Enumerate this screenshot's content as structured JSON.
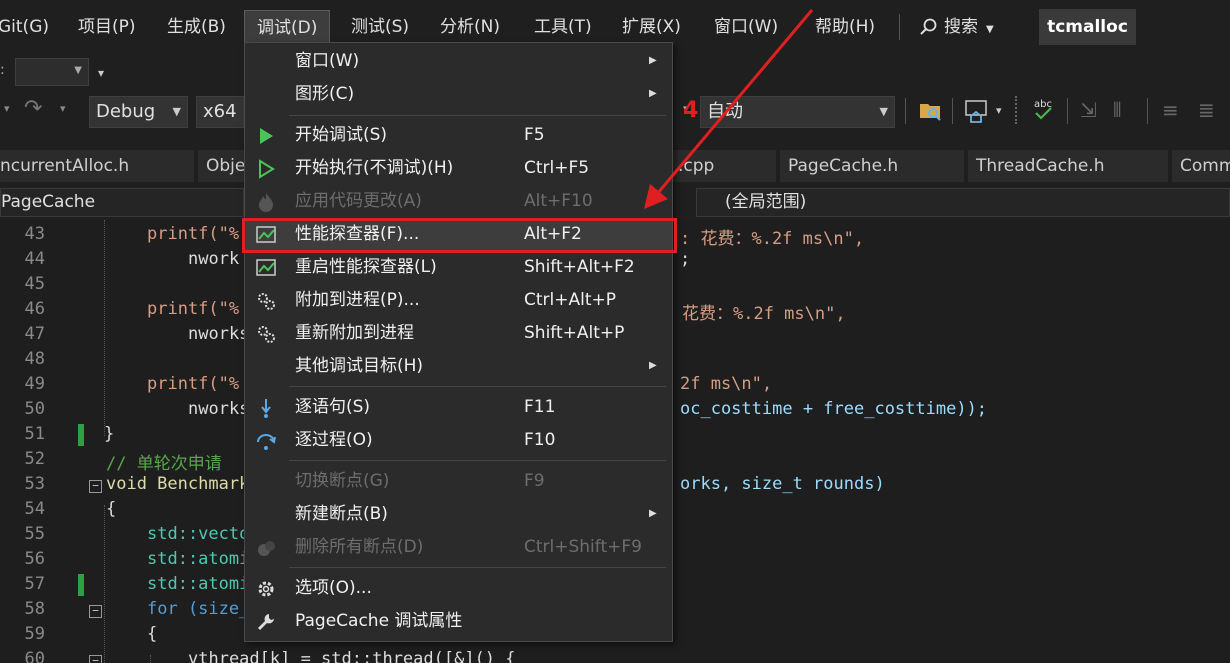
{
  "menubar": {
    "items": [
      "Git(G)",
      "项目(P)",
      "生成(B)",
      "调试(D)",
      "测试(S)",
      "分析(N)",
      "工具(T)",
      "扩展(X)",
      "窗口(W)",
      "帮助(H)"
    ],
    "search_label": "搜索",
    "solution_name": "tcmalloc"
  },
  "toolbar": {
    "config": "Debug",
    "platform": "x64",
    "startup": "自动"
  },
  "tabs": [
    "ncurrentAlloc.h",
    "Obje",
    ".cpp",
    "PageCache.h",
    "ThreadCache.h",
    "Comm"
  ],
  "navbar": {
    "project": "PageCache",
    "scope": "(全局范围)"
  },
  "editor": {
    "line_numbers": [
      "43",
      "44",
      "45",
      "46",
      "47",
      "48",
      "49",
      "50",
      "51",
      "52",
      "53",
      "54",
      "55",
      "56",
      "57",
      "58",
      "59",
      "60"
    ],
    "lines": {
      "l43a": "printf(\"%",
      "l43b": ": 花费：%.2f ms\\n\",",
      "l44a": "nwork",
      "l44b": ";",
      "l46a": "printf(\"%",
      "l46b": "花费：%.2f ms\\n\",",
      "l47a": "nworks",
      "l49a": "printf(\"%",
      "l49b": "2f ms\\n\",",
      "l50a": "nworks",
      "l50b": "oc_costtime + free_costtime));",
      "l51": "}",
      "l52": "// 单轮次申请",
      "l53a": "void Benchmark",
      "l53b": "orks, size_t rounds)",
      "l54": "{",
      "l55": "std::vecto",
      "l56": "std::atomi",
      "l57": "std::atomi",
      "l58": "for (size_",
      "l59": "{",
      "l60": "vthread[k] = std::thread([&]() {"
    }
  },
  "debug_menu": {
    "items": [
      {
        "label": "窗口(W)",
        "shortcut": "",
        "submenu": true
      },
      {
        "label": "图形(C)",
        "shortcut": "",
        "submenu": true
      },
      {
        "label": "开始调试(S)",
        "shortcut": "F5"
      },
      {
        "label": "开始执行(不调试)(H)",
        "shortcut": "Ctrl+F5"
      },
      {
        "label": "应用代码更改(A)",
        "shortcut": "Alt+F10",
        "disabled": true
      },
      {
        "label": "性能探查器(F)...",
        "shortcut": "Alt+F2",
        "highlighted": true
      },
      {
        "label": "重启性能探查器(L)",
        "shortcut": "Shift+Alt+F2"
      },
      {
        "label": "附加到进程(P)...",
        "shortcut": "Ctrl+Alt+P"
      },
      {
        "label": "重新附加到进程",
        "shortcut": "Shift+Alt+P"
      },
      {
        "label": "其他调试目标(H)",
        "shortcut": "",
        "submenu": true
      },
      {
        "label": "逐语句(S)",
        "shortcut": "F11"
      },
      {
        "label": "逐过程(O)",
        "shortcut": "F10"
      },
      {
        "label": "切换断点(G)",
        "shortcut": "F9",
        "disabled": true
      },
      {
        "label": "新建断点(B)",
        "shortcut": "",
        "submenu": true
      },
      {
        "label": "删除所有断点(D)",
        "shortcut": "Ctrl+Shift+F9",
        "disabled": true
      },
      {
        "label": "选项(O)...",
        "shortcut": ""
      },
      {
        "label": "PageCache 调试属性",
        "shortcut": ""
      }
    ]
  },
  "annotation": {
    "step_number": "4",
    "color": "#e02020"
  }
}
